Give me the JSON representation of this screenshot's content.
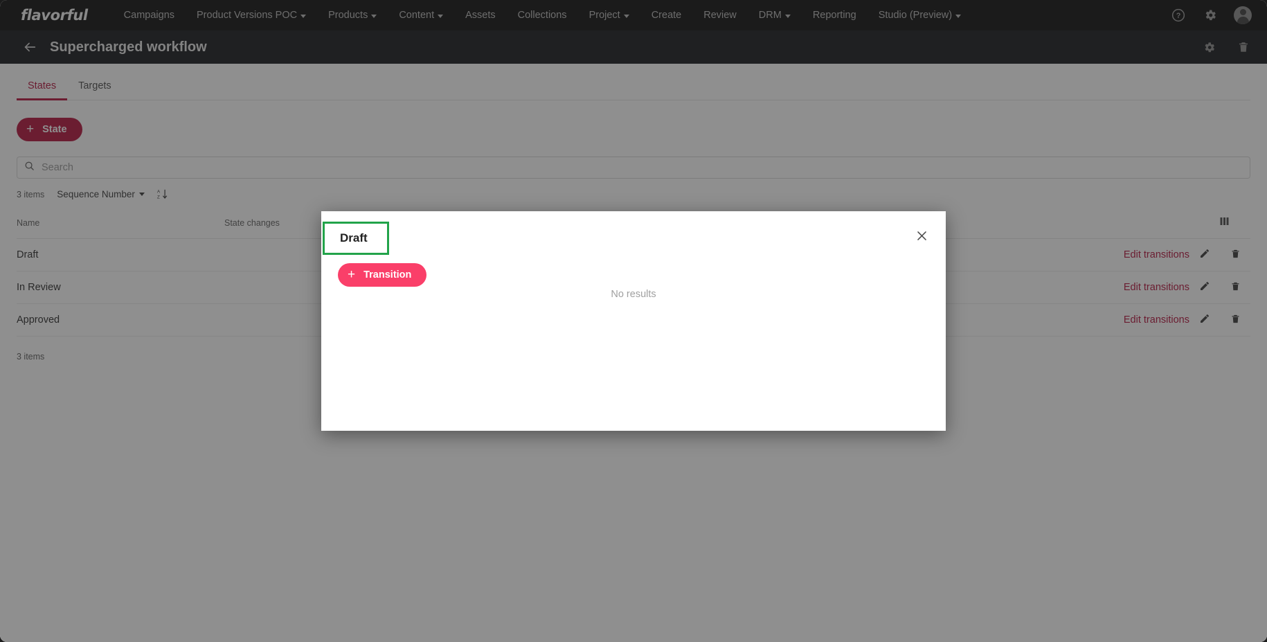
{
  "topnav": {
    "brand": "flavorful",
    "items": [
      {
        "label": "Campaigns",
        "caret": false
      },
      {
        "label": "Product Versions POC",
        "caret": true
      },
      {
        "label": "Products",
        "caret": true
      },
      {
        "label": "Content",
        "caret": true
      },
      {
        "label": "Assets",
        "caret": false
      },
      {
        "label": "Collections",
        "caret": false
      },
      {
        "label": "Project",
        "caret": true
      },
      {
        "label": "Create",
        "caret": false
      },
      {
        "label": "Review",
        "caret": false
      },
      {
        "label": "DRM",
        "caret": true
      },
      {
        "label": "Reporting",
        "caret": false
      },
      {
        "label": "Studio (Preview)",
        "caret": true
      }
    ],
    "help_icon": "help-icon",
    "settings_icon": "gear-icon",
    "avatar": "user-avatar"
  },
  "pagehead": {
    "back_icon": "back-arrow-icon",
    "title": "Supercharged workflow",
    "settings_icon": "gear-icon",
    "delete_icon": "trash-icon"
  },
  "tabs": [
    {
      "label": "States",
      "active": true
    },
    {
      "label": "Targets",
      "active": false
    }
  ],
  "toolbar": {
    "add_state_label": "State",
    "add_state_plus": "+"
  },
  "search": {
    "placeholder": "Search",
    "value": "",
    "icon": "search-icon"
  },
  "listmeta": {
    "count_top": "3 items",
    "sort_field": "Sequence Number",
    "sort_icon": "sort-az-icon",
    "count_bottom": "3 items"
  },
  "table": {
    "columns": [
      "Name",
      "State changes"
    ],
    "config_icon": "column-config-icon",
    "rows": [
      {
        "name": "Draft",
        "state_changes": "",
        "edit_label": "Edit transitions",
        "edit_icon": "pencil-icon",
        "delete_icon": "trash-icon"
      },
      {
        "name": "In Review",
        "state_changes": "",
        "edit_label": "Edit transitions",
        "edit_icon": "pencil-icon",
        "delete_icon": "trash-icon"
      },
      {
        "name": "Approved",
        "state_changes": "",
        "edit_label": "Edit transitions",
        "edit_icon": "pencil-icon",
        "delete_icon": "trash-icon"
      }
    ]
  },
  "modal": {
    "title": "Draft",
    "close_icon": "close-icon",
    "transition_label": "Transition",
    "transition_plus": "+",
    "empty_text": "No results"
  },
  "colors": {
    "brand_crimson": "#b3123c",
    "accent_pink": "#fa3f69",
    "topnav_bg": "#0e0e0e",
    "pagehead_bg": "#16171c",
    "highlight_green": "#22a34a"
  }
}
